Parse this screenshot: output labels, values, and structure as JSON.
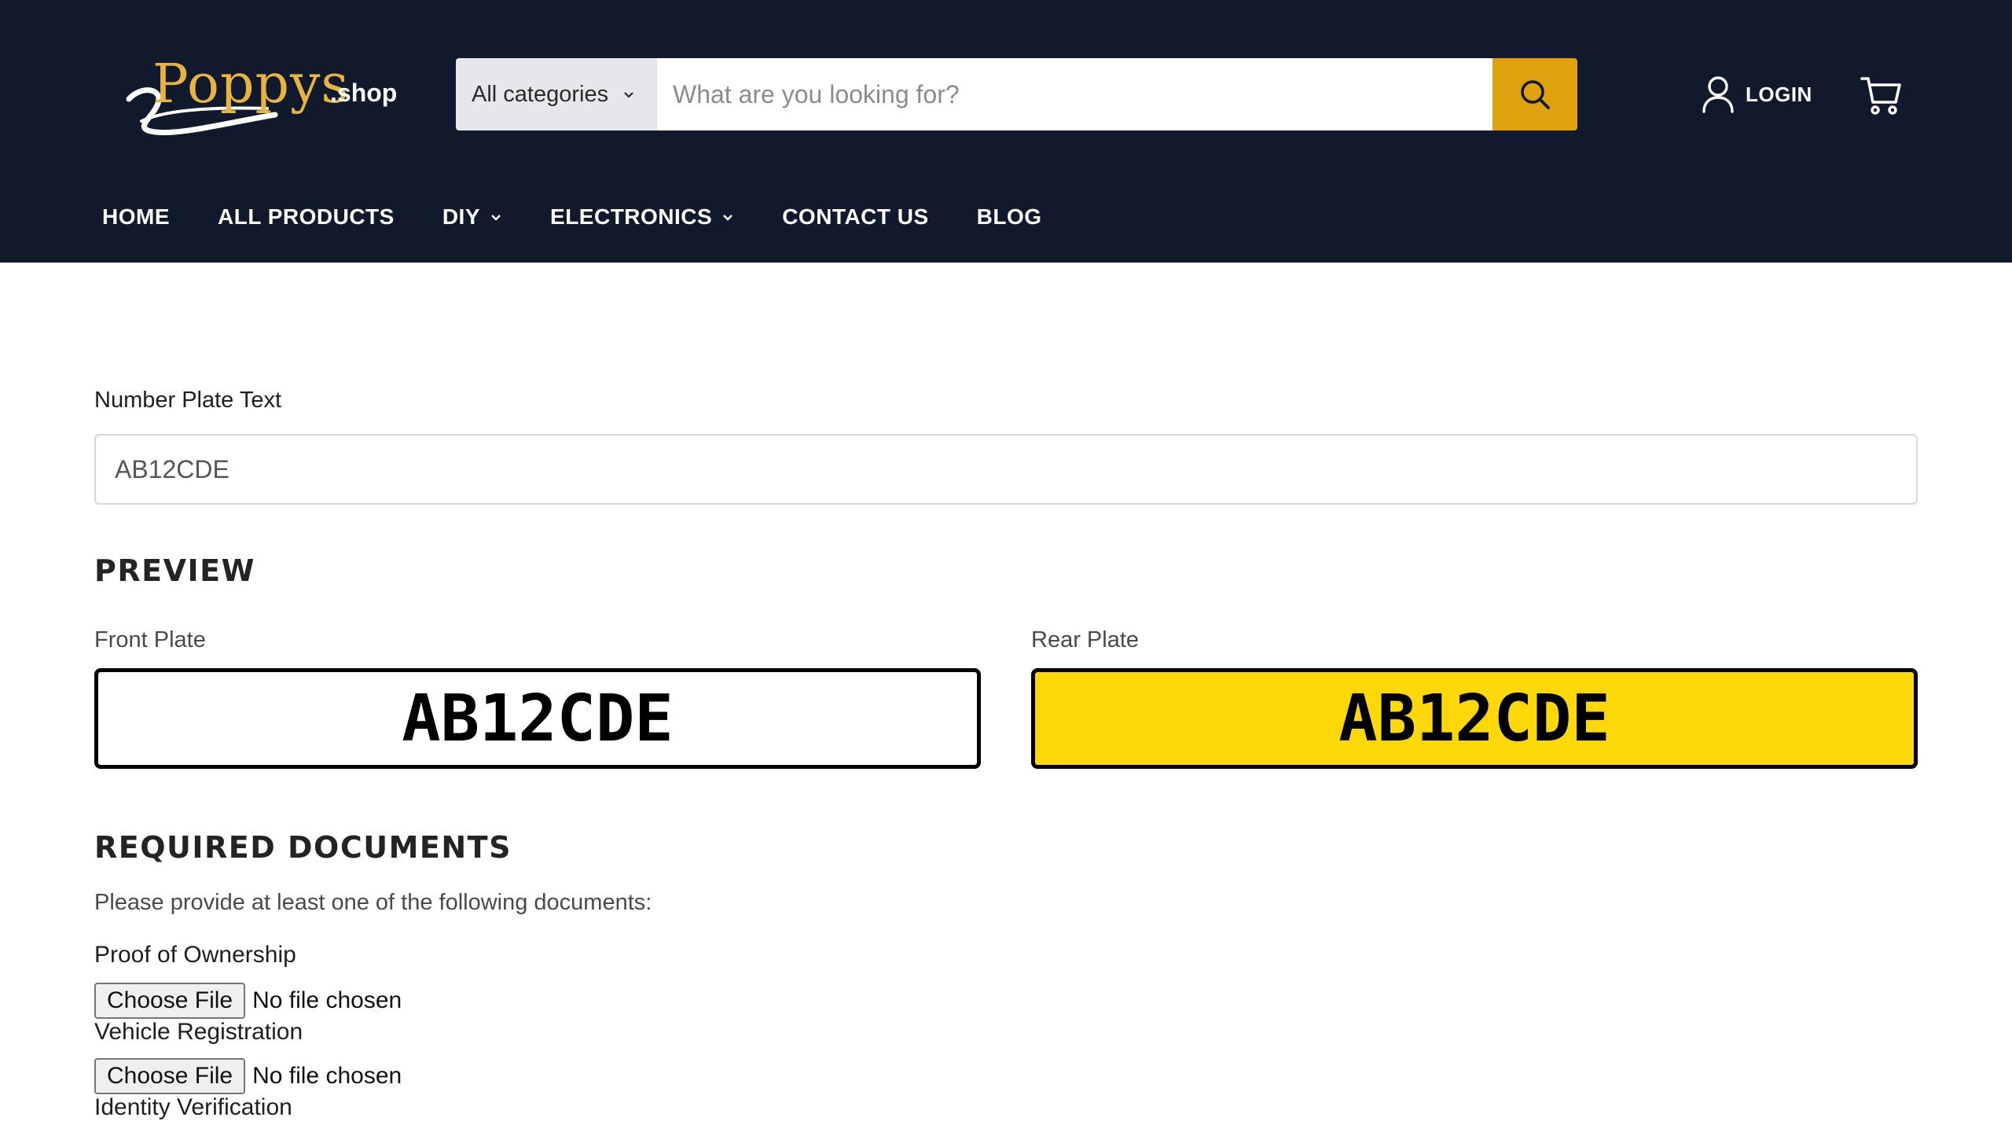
{
  "header": {
    "logo": {
      "word": "Poppys",
      "suffix": ".shop"
    },
    "search": {
      "category_label": "All categories",
      "placeholder": "What are you looking for?"
    },
    "login_label": "LOGIN",
    "nav": [
      {
        "label": "HOME",
        "has_dropdown": false
      },
      {
        "label": "ALL PRODUCTS",
        "has_dropdown": false
      },
      {
        "label": "DIY",
        "has_dropdown": true
      },
      {
        "label": "ELECTRONICS",
        "has_dropdown": true
      },
      {
        "label": "CONTACT US",
        "has_dropdown": false
      },
      {
        "label": "BLOG",
        "has_dropdown": false
      }
    ],
    "colors": {
      "background": "#111a2c",
      "accent": "#e0a10f",
      "logo": "#e9b341"
    }
  },
  "form": {
    "plate_text_label": "Number Plate Text",
    "plate_text_value": "AB12CDE"
  },
  "preview": {
    "heading": "PREVIEW",
    "front_label": "Front Plate",
    "rear_label": "Rear Plate",
    "front_text": "AB12CDE",
    "rear_text": "AB12CDE",
    "colors": {
      "front": "#ffffff",
      "rear": "#fcd70a"
    }
  },
  "documents": {
    "heading": "REQUIRED DOCUMENTS",
    "intro": "Please provide at least one of the following documents:",
    "items": [
      {
        "label": "Proof of Ownership",
        "button": "Choose File",
        "status": "No file chosen"
      },
      {
        "label": "Vehicle Registration",
        "button": "Choose File",
        "status": "No file chosen"
      },
      {
        "label": "Identity Verification"
      }
    ]
  },
  "icons": {
    "search": "search-icon",
    "user": "user-icon",
    "cart": "cart-icon",
    "chevron": "chevron-down-icon"
  }
}
